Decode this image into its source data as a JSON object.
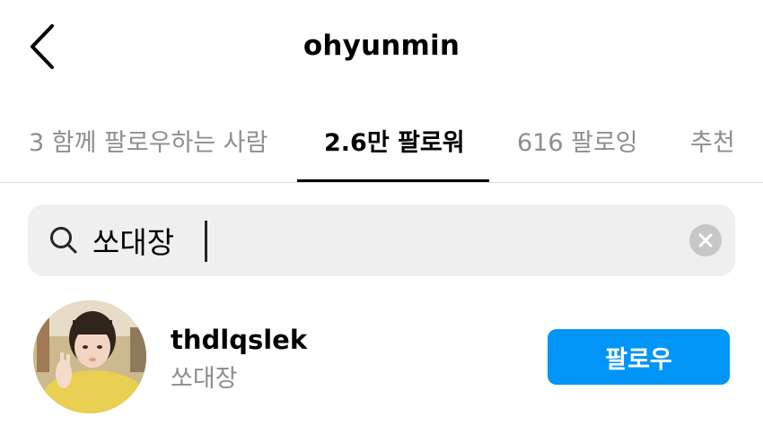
{
  "header": {
    "title": "ohyunmin"
  },
  "tabs": [
    {
      "label": "3 함께 팔로우하는 사람",
      "active": false
    },
    {
      "label": "2.6만 팔로워",
      "active": true
    },
    {
      "label": "616 팔로잉",
      "active": false
    },
    {
      "label": "추천",
      "active": false
    }
  ],
  "search": {
    "value": "쏘대장",
    "icon": "search-icon",
    "clear_icon": "clear-icon"
  },
  "results": [
    {
      "username": "thdlqslek",
      "full_name": "쏘대장",
      "button_label": "팔로우"
    }
  ],
  "colors": {
    "accent": "#0095f6",
    "muted_text": "#8e8e8e",
    "search_bg": "#efefef"
  }
}
